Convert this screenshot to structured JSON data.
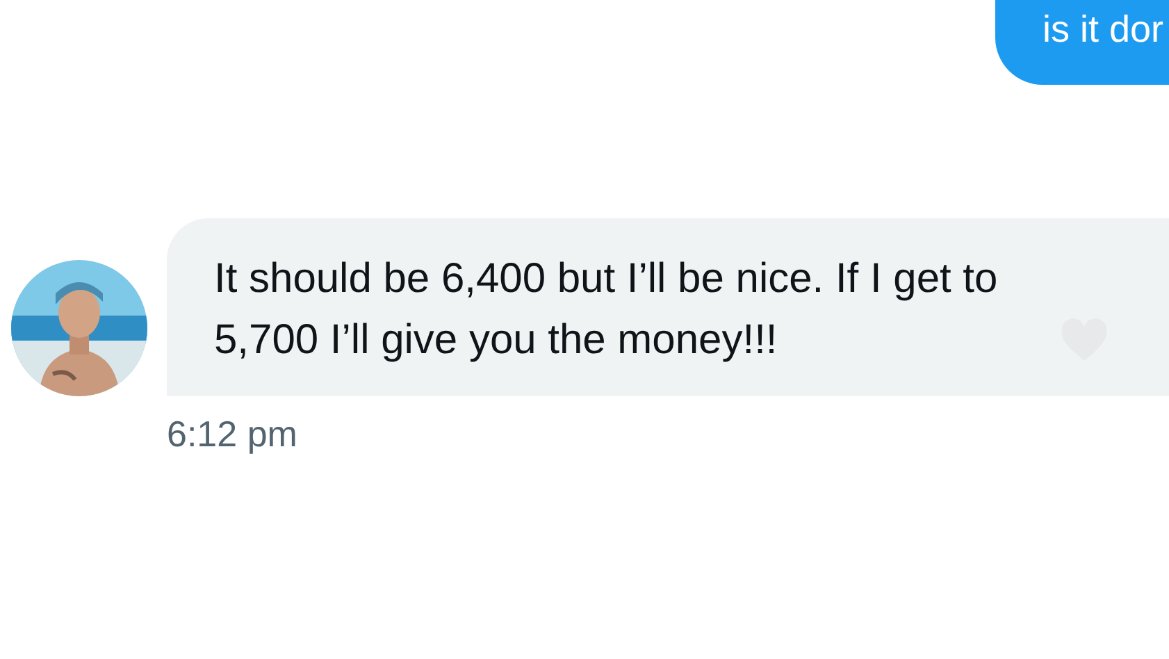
{
  "messages": [
    {
      "kind": "sent",
      "text": "is it dor"
    },
    {
      "kind": "received",
      "text": "It should be 6,400 but I’ll be nice. If I get to 5,700 I’ll give you the money!!!",
      "liked": false,
      "time": "6:12 pm"
    }
  ]
}
